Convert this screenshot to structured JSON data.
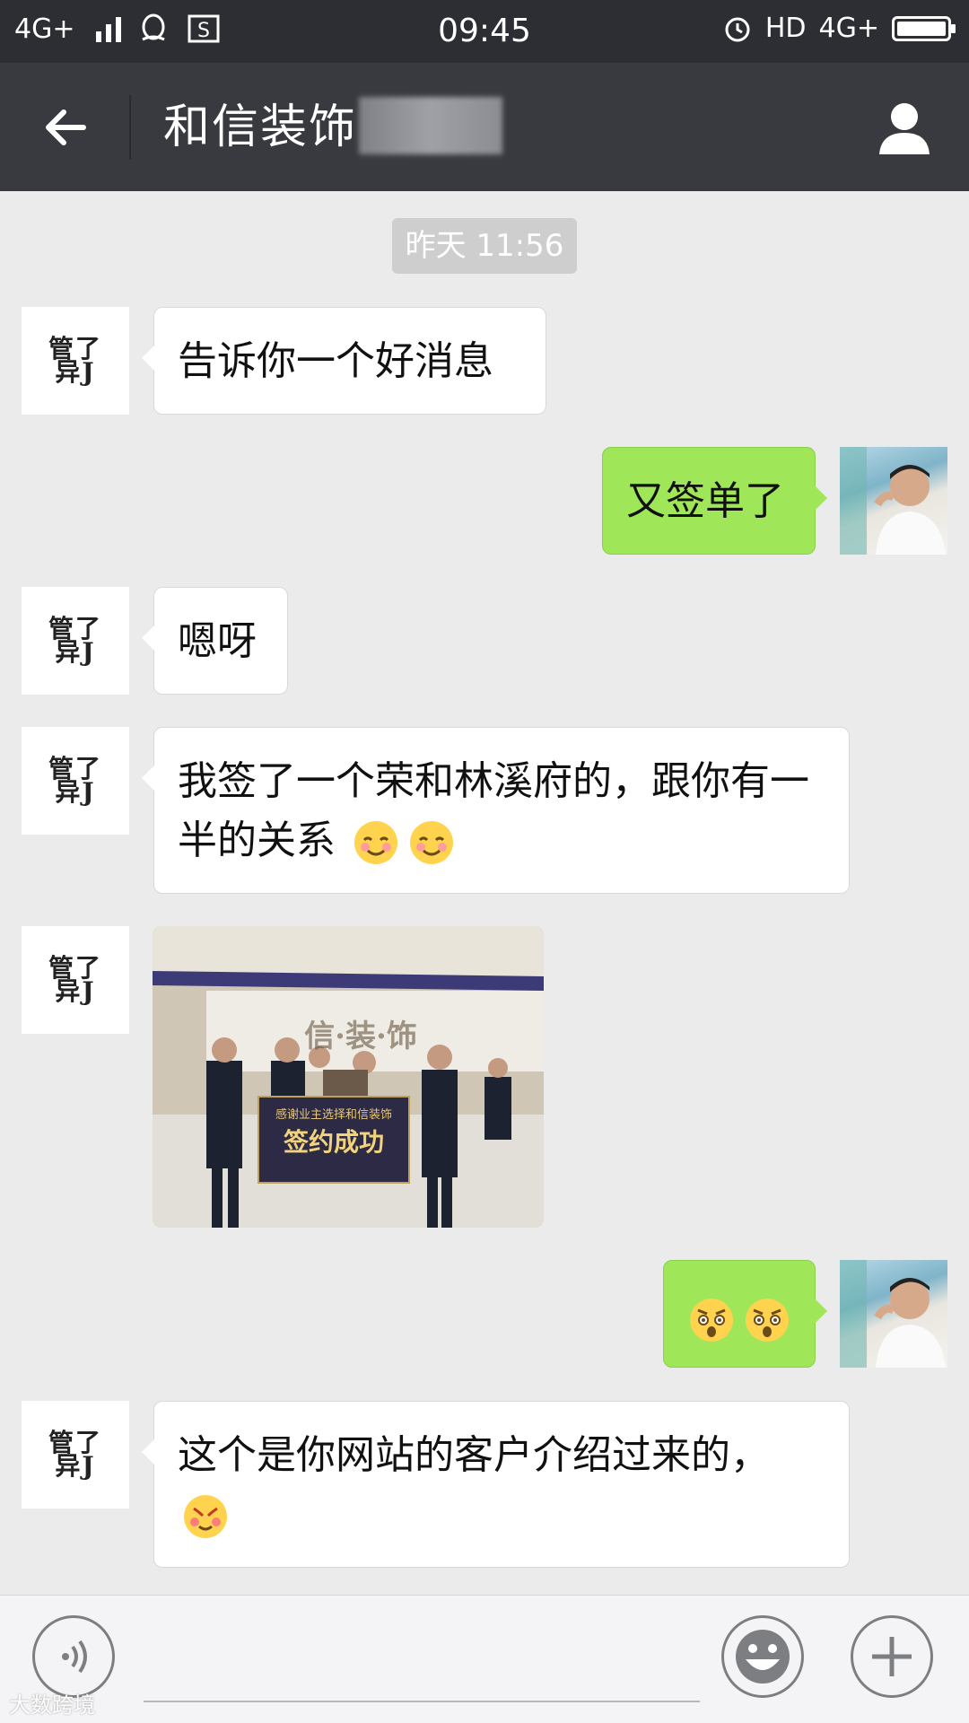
{
  "status_bar": {
    "network_left": "4G+",
    "time": "09:45",
    "hd_label": "HD",
    "network_right": "4G+",
    "icons": [
      "signal-icon",
      "qq-icon",
      "screenshot-icon",
      "alarm-icon",
      "battery-icon"
    ]
  },
  "header": {
    "title": "和信装饰",
    "icons": [
      "back-arrow-icon",
      "profile-icon"
    ]
  },
  "messages": {
    "timestamp": "昨天 11:56",
    "m1": "告诉你一个好消息",
    "m2": "又签单了",
    "m3": "嗯呀",
    "m4": "我签了一个荣和林溪府的，跟你有一半的关系",
    "m7": "这个是你网站的客户介绍过来的，"
  },
  "company_avatar_logo": "管了\n异J",
  "photo": {
    "banner_text": "签约成功",
    "sign_line": "感谢业主选择和信装饰",
    "wall_text": "信·装·饰"
  },
  "input_bar": {
    "icons": [
      "voice-icon",
      "emoji-icon",
      "plus-icon"
    ]
  },
  "watermark": "大数跨境",
  "colors": {
    "status_bar": "#2c2e33",
    "header": "#393a3f",
    "background": "#ebebeb",
    "bubble_self": "#9fe658",
    "bubble_other": "#ffffff"
  }
}
